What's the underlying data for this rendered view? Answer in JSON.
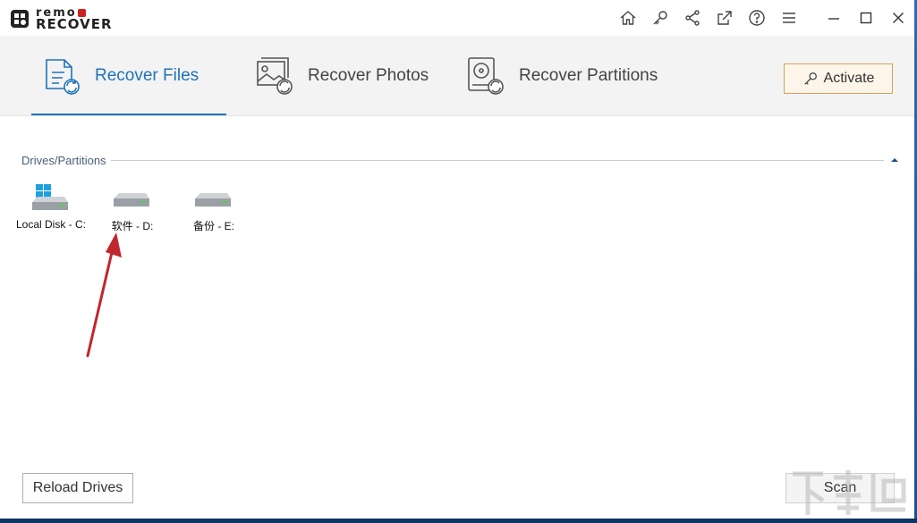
{
  "app": {
    "logo_line1": "remo",
    "logo_line2": "RECOVER"
  },
  "titlebar_icons": [
    "home-icon",
    "key-icon",
    "share-icon",
    "export-icon",
    "help-icon",
    "menu-icon",
    "minimize-icon",
    "maximize-icon",
    "close-icon"
  ],
  "tabs": [
    {
      "label": "Recover Files",
      "active": true
    },
    {
      "label": "Recover Photos",
      "active": false
    },
    {
      "label": "Recover Partitions",
      "active": false
    }
  ],
  "activate_label": "Activate",
  "section": {
    "title": "Drives/Partitions"
  },
  "drives": [
    {
      "label": "Local Disk - C:",
      "system": true
    },
    {
      "label": "软件 - D:",
      "system": false
    },
    {
      "label": "备份 - E:",
      "system": false
    }
  ],
  "buttons": {
    "reload": "Reload Drives",
    "scan": "Scan"
  },
  "colors": {
    "accent": "#1f73b7",
    "activate_border": "#d9a15c",
    "annotation_arrow": "#c0272d"
  }
}
